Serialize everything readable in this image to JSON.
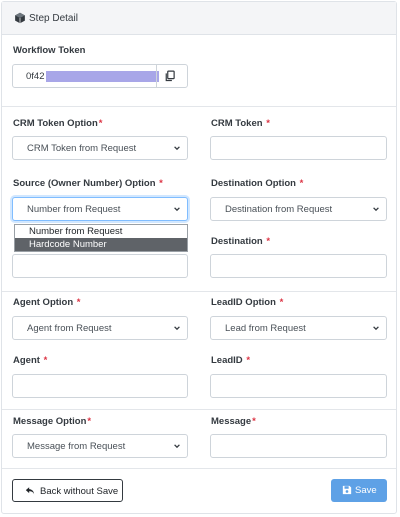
{
  "header": {
    "title": "Step Detail",
    "icon": "cube-icon"
  },
  "workflow_token": {
    "label": "Workflow Token",
    "value_prefix": "0f42",
    "copy_icon": "copy-icon"
  },
  "fields": {
    "crm_token_option": {
      "label": "CRM Token Option",
      "value": "CRM Token from Request"
    },
    "crm_token": {
      "label": "CRM Token",
      "value": ""
    },
    "source_option": {
      "label": "Source (Owner Number) Option",
      "value": "Number from Request"
    },
    "destination_option": {
      "label": "Destination Option",
      "value": "Destination from Request"
    },
    "destination": {
      "label": "Destination",
      "value": ""
    },
    "agent_option": {
      "label": "Agent Option",
      "value": "Agent from Request"
    },
    "leadid_option": {
      "label": "LeadID Option",
      "value": "Lead from Request"
    },
    "agent": {
      "label": "Agent",
      "value": ""
    },
    "leadid": {
      "label": "LeadID",
      "value": ""
    },
    "message_option": {
      "label": "Message Option",
      "value": "Message from Request"
    },
    "message": {
      "label": "Message",
      "value": ""
    }
  },
  "source_dropdown": {
    "options": [
      "Number from Request",
      "Hardcode Number"
    ],
    "highlighted": "Hardcode Number"
  },
  "footer": {
    "back_label": "Back without Save",
    "save_label": "Save"
  },
  "colors": {
    "required": "#dc3545",
    "save_button": "#5ea1e6",
    "focus_border": "#80bdff"
  }
}
